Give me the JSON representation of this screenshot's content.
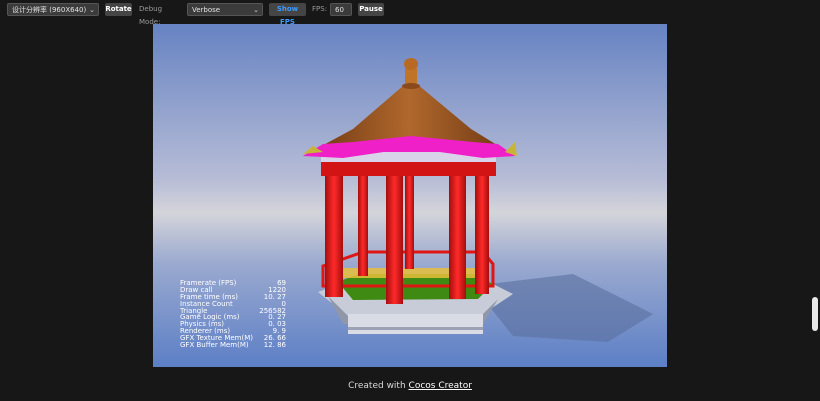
{
  "toolbar": {
    "resolution_value": "设计分辨率 (960X640)",
    "rotate_label": "Rotate",
    "debug_mode_label": "Debug Mode:",
    "debug_mode_value": "Verbose",
    "show_fps_label": "Show FPS",
    "fps_label": "FPS:",
    "fps_value": "60",
    "pause_label": "Pause"
  },
  "stats": [
    {
      "label": "Framerate (FPS)",
      "value": "69"
    },
    {
      "label": "Draw call",
      "value": "1220"
    },
    {
      "label": "Frame time (ms)",
      "value": "10. 27"
    },
    {
      "label": "Instance Count",
      "value": "0"
    },
    {
      "label": "Triangle",
      "value": "256582"
    },
    {
      "label": "Game Logic (ms)",
      "value": "0. 27"
    },
    {
      "label": "Physics (ms)",
      "value": "0. 03"
    },
    {
      "label": "Renderer (ms)",
      "value": "9. 9"
    },
    {
      "label": "GFX Texture Mem(M)",
      "value": "26. 66"
    },
    {
      "label": "GFX Buffer Mem(M)",
      "value": "12. 86"
    }
  ],
  "footer": {
    "prefix": "Created with ",
    "link": "Cocos Creator"
  },
  "colors": {
    "background": "#171717",
    "sky_top": "#6b86c4",
    "sky_mid": "#c9cbd8",
    "pillar": "#e01515",
    "roof": "#8a4a1c",
    "accent": "#3d9bff"
  },
  "icons": {
    "select_chevron": "chevron-down-icon"
  }
}
